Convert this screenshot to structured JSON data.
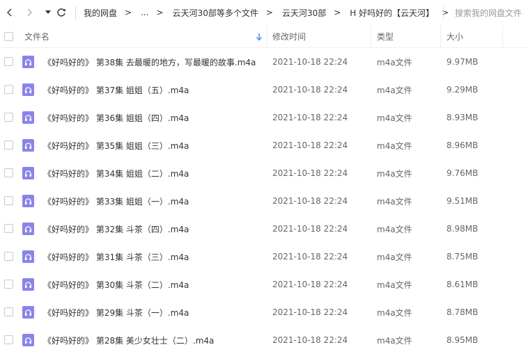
{
  "toolbar": {
    "breadcrumbs": [
      {
        "label": "我的网盘"
      },
      {
        "label": "..."
      },
      {
        "label": "云天河30部等多个文件"
      },
      {
        "label": "云天河30部"
      },
      {
        "label": "H 好吗好的【云天河】"
      }
    ],
    "search_placeholder": "搜索我的网盘文件"
  },
  "table": {
    "headers": {
      "name": "文件名",
      "modified": "修改时间",
      "type": "类型",
      "size": "大小"
    },
    "sort": {
      "column": "name",
      "direction": "desc"
    },
    "rows": [
      {
        "name": "《好吗好的》 第38集 去最暖的地方，写最暖的故事.m4a",
        "modified": "2021-10-18 22:24",
        "type": "m4a文件",
        "size": "9.97MB"
      },
      {
        "name": "《好吗好的》 第37集 姐姐（五）.m4a",
        "modified": "2021-10-18 22:24",
        "type": "m4a文件",
        "size": "9.29MB"
      },
      {
        "name": "《好吗好的》 第36集 姐姐（四）.m4a",
        "modified": "2021-10-18 22:24",
        "type": "m4a文件",
        "size": "8.93MB"
      },
      {
        "name": "《好吗好的》 第35集 姐姐（三）.m4a",
        "modified": "2021-10-18 22:24",
        "type": "m4a文件",
        "size": "8.96MB"
      },
      {
        "name": "《好吗好的》 第34集 姐姐（二）.m4a",
        "modified": "2021-10-18 22:24",
        "type": "m4a文件",
        "size": "9.76MB"
      },
      {
        "name": "《好吗好的》 第33集 姐姐（一）.m4a",
        "modified": "2021-10-18 22:24",
        "type": "m4a文件",
        "size": "9.51MB"
      },
      {
        "name": "《好吗好的》 第32集 斗茶（四）.m4a",
        "modified": "2021-10-18 22:24",
        "type": "m4a文件",
        "size": "8.98MB"
      },
      {
        "name": "《好吗好的》 第31集 斗茶（三）.m4a",
        "modified": "2021-10-18 22:24",
        "type": "m4a文件",
        "size": "8.75MB"
      },
      {
        "name": "《好吗好的》 第30集 斗茶（二）.m4a",
        "modified": "2021-10-18 22:24",
        "type": "m4a文件",
        "size": "8.61MB"
      },
      {
        "name": "《好吗好的》 第29集 斗茶（一）.m4a",
        "modified": "2021-10-18 22:24",
        "type": "m4a文件",
        "size": "8.78MB"
      },
      {
        "name": "《好吗好的》 第28集 美少女壮士（二）.m4a",
        "modified": "2021-10-18 22:24",
        "type": "m4a文件",
        "size": "8.95MB"
      }
    ]
  },
  "icons": {
    "back": "chevron-left-icon",
    "forward": "chevron-right-icon",
    "history": "caret-down-icon",
    "refresh": "refresh-icon",
    "sort": "sort-down-icon",
    "file": "audio-file-icon"
  },
  "colors": {
    "file_icon": "#8a84e8",
    "sort_arrow": "#4a90e2"
  }
}
